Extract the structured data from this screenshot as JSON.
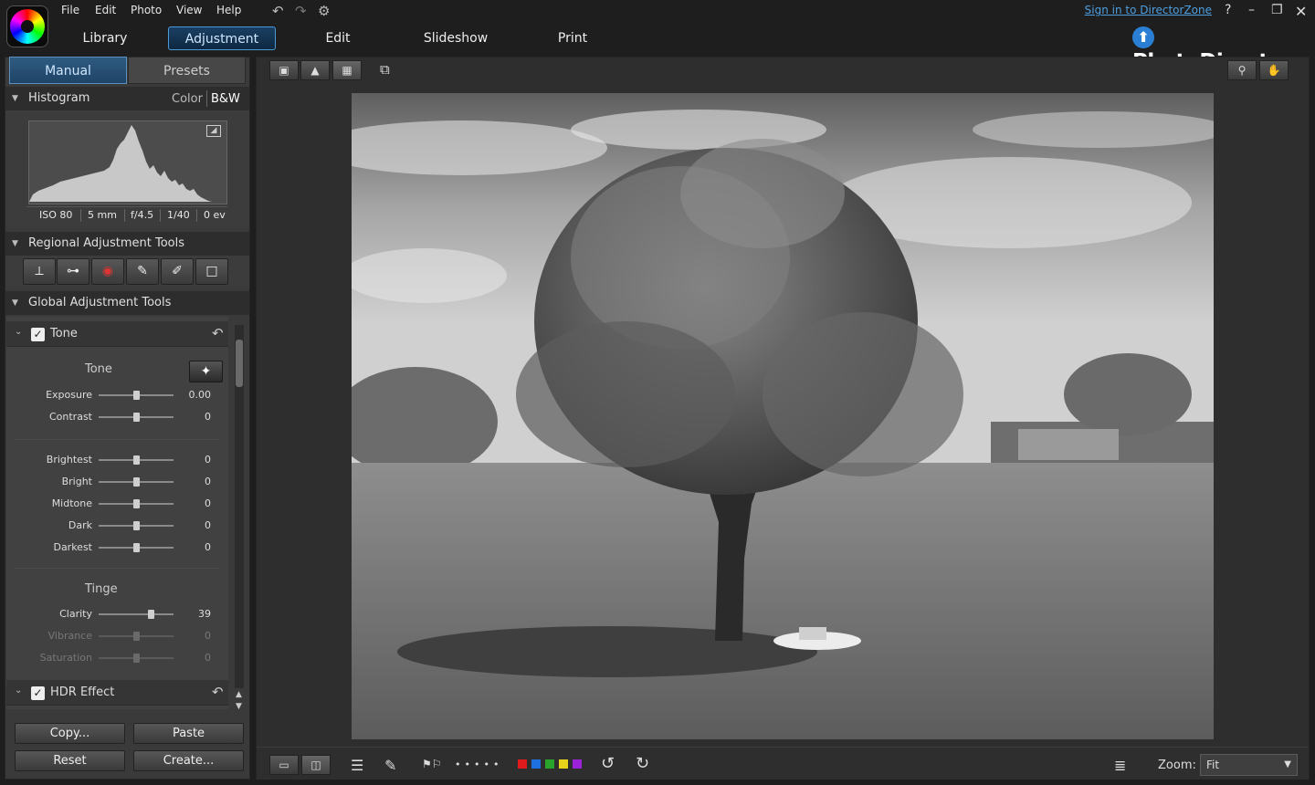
{
  "menu": [
    "File",
    "Edit",
    "Photo",
    "View",
    "Help"
  ],
  "mode_tabs": [
    "Library",
    "Adjustment",
    "Edit",
    "Slideshow",
    "Print"
  ],
  "active_mode": "Adjustment",
  "signin": "Sign in to DirectorZone",
  "brand": "PhotoDirector",
  "panel_tabs": {
    "manual": "Manual",
    "presets": "Presets"
  },
  "histogram": {
    "title": "Histogram",
    "color": "Color",
    "bw": "B&W",
    "exif": [
      "ISO 80",
      "5 mm",
      "f/4.5",
      "1/40",
      "0 ev"
    ]
  },
  "regional": {
    "title": "Regional Adjustment Tools",
    "tools": [
      "crop-tool-icon",
      "spot-removal-icon",
      "red-eye-icon",
      "adjustment-brush-icon",
      "graduated-filter-icon",
      "radial-filter-icon"
    ]
  },
  "global": {
    "title": "Global Adjustment Tools"
  },
  "tone_section": {
    "title": "Tone",
    "group1": "Tone",
    "group2": "Tinge",
    "sliders": [
      {
        "label": "Exposure",
        "value": "0.00",
        "pos": 0.5
      },
      {
        "label": "Contrast",
        "value": "0",
        "pos": 0.5
      },
      {
        "label": "Brightest",
        "value": "0",
        "pos": 0.5
      },
      {
        "label": "Bright",
        "value": "0",
        "pos": 0.5
      },
      {
        "label": "Midtone",
        "value": "0",
        "pos": 0.5
      },
      {
        "label": "Dark",
        "value": "0",
        "pos": 0.5
      },
      {
        "label": "Darkest",
        "value": "0",
        "pos": 0.5
      },
      {
        "label": "Clarity",
        "value": "39",
        "pos": 0.695
      },
      {
        "label": "Vibrance",
        "value": "0",
        "pos": 0.5
      },
      {
        "label": "Saturation",
        "value": "0",
        "pos": 0.5
      }
    ]
  },
  "hdr_section": {
    "title": "HDR Effect"
  },
  "buttons": {
    "copy": "Copy...",
    "paste": "Paste",
    "reset": "Reset",
    "create": "Create..."
  },
  "zoom": {
    "label": "Zoom:",
    "value": "Fit"
  },
  "color_labels": [
    "#e01b1b",
    "#1e6fe0",
    "#29a329",
    "#e6d31a",
    "#9b22d6"
  ],
  "accent": "#4a9ad8"
}
